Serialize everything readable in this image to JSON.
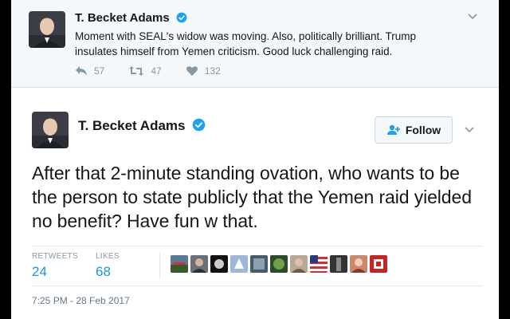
{
  "reply_tweet": {
    "author": "T. Becket Adams",
    "text": "Moment with SEAL's widow was moving. Also, politically brilliant. Trump insulates himself from Yemen criticism. Good luck challenging raid.",
    "replies": "57",
    "retweets": "47",
    "likes": "132"
  },
  "main_tweet": {
    "author": "T. Becket Adams",
    "follow_label": "Follow",
    "text": "After that 2-minute standing ovation, who wants to be the person to state publicly that the Yemen raid yielded no benefit? Have fun w that.",
    "retweets_label": "RETWEETS",
    "retweets_count": "24",
    "likes_label": "LIKES",
    "likes_count": "68",
    "timestamp": "7:25 PM - 28 Feb 2017"
  },
  "colors": {
    "accent": "#1b95e0",
    "muted": "#8899a6",
    "verified": "#1da1f2"
  },
  "likers": [
    {
      "icon": "landscape-photo"
    },
    {
      "icon": "person-photo"
    },
    {
      "icon": "moon-photo"
    },
    {
      "icon": "blue-logo"
    },
    {
      "icon": "ice-photo"
    },
    {
      "icon": "green-photo"
    },
    {
      "icon": "person-photo"
    },
    {
      "icon": "us-flag"
    },
    {
      "icon": "statue-photo"
    },
    {
      "icon": "woman-photo"
    },
    {
      "icon": "red-logo"
    }
  ]
}
